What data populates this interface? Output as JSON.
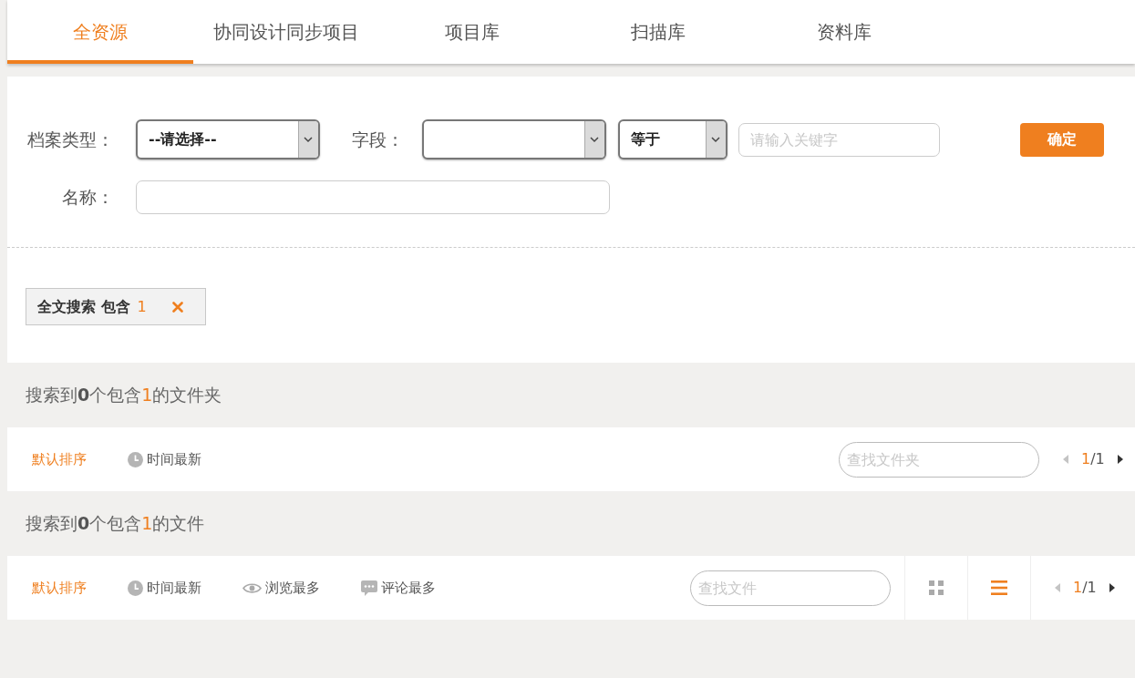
{
  "tabs": [
    {
      "label": "全资源",
      "selected": true
    },
    {
      "label": "协同设计同步项目",
      "selected": false
    },
    {
      "label": "项目库",
      "selected": false
    },
    {
      "label": "扫描库",
      "selected": false
    },
    {
      "label": "资料库",
      "selected": false
    }
  ],
  "filter_form": {
    "archive_type": {
      "label": "档案类型：",
      "value": "--请选择--"
    },
    "field": {
      "label": "字段："
    },
    "operator": {
      "value": "等于"
    },
    "keyword": {
      "placeholder": "请输入关键字"
    },
    "confirm_button": "确定",
    "name": {
      "label": "名称："
    }
  },
  "active_filters": [
    {
      "label": "全文搜索 包含",
      "value": "1"
    }
  ],
  "folder_results": {
    "summary": [
      {
        "kind": "plain",
        "text": "搜索到"
      },
      {
        "kind": "count",
        "text": "0"
      },
      {
        "kind": "plain",
        "text": "个包含"
      },
      {
        "kind": "keyword",
        "text": "1"
      },
      {
        "kind": "plain",
        "text": "的文件夹"
      }
    ],
    "sort_options": [
      {
        "kind": "default",
        "label": "默认排序",
        "selected": true
      },
      {
        "kind": "time",
        "label": "时间最新",
        "selected": false
      }
    ],
    "search": {
      "placeholder": "查找文件夹"
    },
    "pager": {
      "current": "1",
      "total": "/1",
      "prev_disabled": true,
      "next_disabled": false
    }
  },
  "file_results": {
    "summary": [
      {
        "kind": "plain",
        "text": "搜索到"
      },
      {
        "kind": "count",
        "text": "0"
      },
      {
        "kind": "plain",
        "text": "个包含"
      },
      {
        "kind": "keyword",
        "text": "1"
      },
      {
        "kind": "plain",
        "text": "的文件"
      }
    ],
    "sort_options": [
      {
        "kind": "default",
        "label": "默认排序",
        "selected": true
      },
      {
        "kind": "time",
        "label": "时间最新",
        "selected": false
      },
      {
        "kind": "views",
        "label": "浏览最多",
        "selected": false
      },
      {
        "kind": "comments",
        "label": "评论最多",
        "selected": false
      }
    ],
    "search": {
      "placeholder": "查找文件"
    },
    "view_modes": [
      {
        "kind": "grid",
        "selected": false
      },
      {
        "kind": "list",
        "selected": true
      }
    ],
    "pager": {
      "current": "1",
      "total": "/1",
      "prev_disabled": true,
      "next_disabled": false
    }
  }
}
